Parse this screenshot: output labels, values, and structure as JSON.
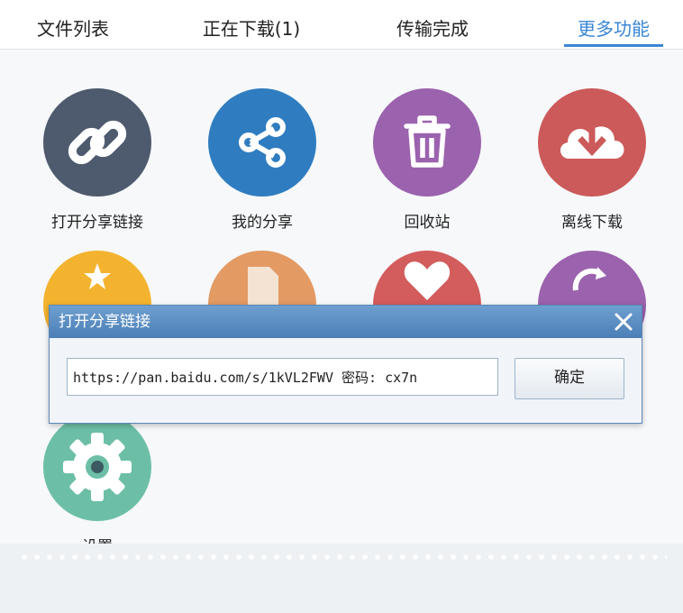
{
  "tabs": [
    {
      "label": "文件列表"
    },
    {
      "label": "正在下载(1)"
    },
    {
      "label": "传输完成"
    },
    {
      "label": "更多功能"
    }
  ],
  "grid": {
    "open_share_link": {
      "label": "打开分享链接",
      "icon": "link-icon",
      "color": "#4e5a6e"
    },
    "my_share": {
      "label": "我的分享",
      "icon": "share-icon",
      "color": "#2f7dc0"
    },
    "recycle_bin": {
      "label": "回收站",
      "icon": "trash-icon",
      "color": "#9b62ad"
    },
    "offline_download": {
      "label": "离线下载",
      "icon": "cloud-download-icon",
      "color": "#cc5a5a"
    },
    "settings": {
      "label": "设置",
      "icon": "gear-icon",
      "color": "#6cbfa6"
    }
  },
  "dialog": {
    "title": "打开分享链接",
    "url_value": "https://pan.baidu.com/s/1kVL2FWV 密码: cx7n",
    "confirm_label": "确定"
  },
  "colors": {
    "accent": "#3a86d4",
    "dialog_title_bar": "#5a8cc2"
  }
}
